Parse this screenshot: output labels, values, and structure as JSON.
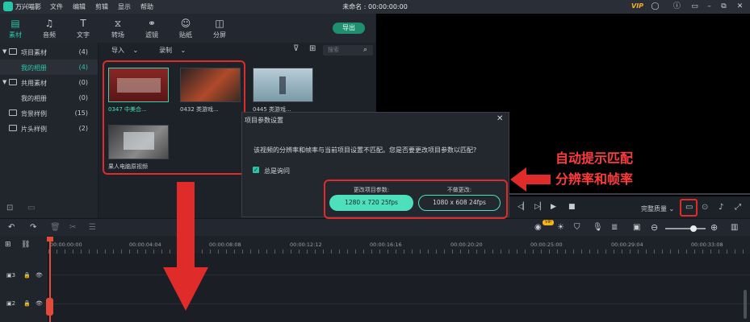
{
  "titlebar": {
    "app_name": "万兴喵影",
    "menu": [
      "文件",
      "编辑",
      "剪辑",
      "显示",
      "帮助"
    ],
    "window_title": "未命名 : 00:00:00:00",
    "vip": "VIP"
  },
  "tabs": [
    {
      "label": "素材",
      "icon": "media-icon",
      "glyph": "▤"
    },
    {
      "label": "音频",
      "icon": "music-note-icon",
      "glyph": "♫"
    },
    {
      "label": "文字",
      "icon": "text-icon",
      "glyph": "T"
    },
    {
      "label": "转场",
      "icon": "transition-icon",
      "glyph": "⧖"
    },
    {
      "label": "滤镜",
      "icon": "filter-icon",
      "glyph": "⚭"
    },
    {
      "label": "贴纸",
      "icon": "sticker-icon",
      "glyph": "☺"
    },
    {
      "label": "分屏",
      "icon": "split-screen-icon",
      "glyph": "◫"
    }
  ],
  "export_label": "导出",
  "sidebar": {
    "items": [
      {
        "label": "项目素材",
        "count": "(4)"
      },
      {
        "label": "我的相册",
        "count": "(4)"
      },
      {
        "label": "共用素材",
        "count": "(0)"
      },
      {
        "label": "我的相册",
        "count": "(0)"
      },
      {
        "label": "背景样例",
        "count": "(15)"
      },
      {
        "label": "片头样例",
        "count": "(2)"
      }
    ]
  },
  "media_bar": {
    "import_label": "导入",
    "record_label": "录制",
    "search_placeholder": "搜索"
  },
  "media_items": [
    {
      "caption": "0347 中美合..."
    },
    {
      "caption": "0432 类游戏..."
    },
    {
      "caption": "0445 类游戏..."
    },
    {
      "caption": "果人电脑原视频"
    }
  ],
  "dialog": {
    "title": "项目参数设置",
    "message": "该视频的分辨率和帧率与当前项目设置不匹配。您是否要更改项目参数以匹配?",
    "checkbox_label": "总是询问",
    "change_label": "更改项目参数:",
    "keep_label": "不做更改:",
    "change_value": "1280 x 720 25fps",
    "keep_value": "1080 x 608 24fps"
  },
  "player": {
    "quality_label": "完整质量"
  },
  "ruler_ticks": [
    "00:00:00:00",
    "00:00:04:04",
    "00:00:08:08",
    "00:00:12:12",
    "00:00:16:16",
    "00:00:20:20",
    "00:00:25:00",
    "00:00:29:04",
    "00:00:33:08"
  ],
  "tracks": [
    {
      "label": "3"
    },
    {
      "label": "2"
    }
  ],
  "annotation": {
    "line1": "自动提示匹配",
    "line2": "分辨率和帧率"
  },
  "colors": {
    "accent": "#29c5a8",
    "annotation_red": "#e02b2b"
  }
}
